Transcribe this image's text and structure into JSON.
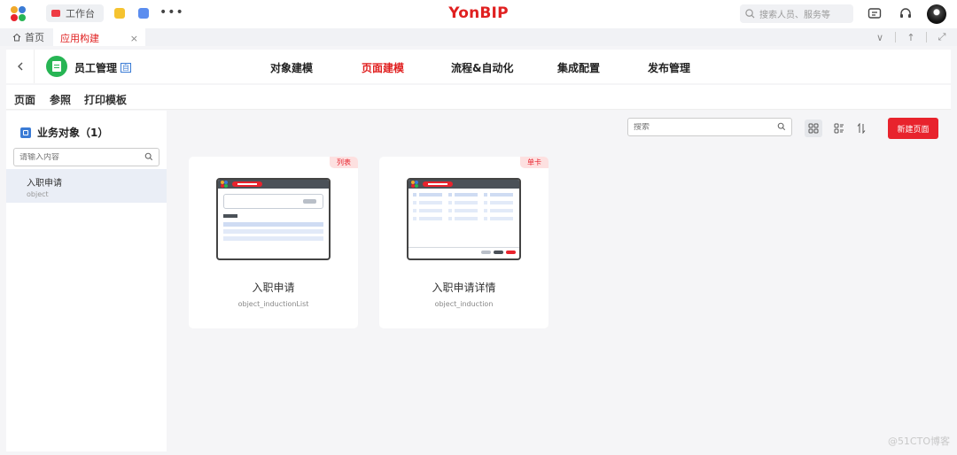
{
  "topbar": {
    "workbench_label": "工作台",
    "brand": "YonBIP",
    "search_placeholder": "搜索人员、服务等",
    "more_label": "•••"
  },
  "tabs": {
    "home_label": "首页",
    "active_label": "应用构建",
    "close_label": "×",
    "right_icons": [
      "∨",
      "↑",
      "⤢"
    ]
  },
  "header": {
    "app_name": "员工管理",
    "app_tag": "自",
    "nav": [
      "对象建模",
      "页面建模",
      "流程&自动化",
      "集成配置",
      "发布管理"
    ],
    "active_nav": "页面建模"
  },
  "subtabs": {
    "items": [
      "页面",
      "参照",
      "打印模板"
    ],
    "active": "页面"
  },
  "sidebar": {
    "title": "业务对象（1）",
    "search_placeholder": "请输入内容",
    "items": [
      {
        "name": "入职申请",
        "sub": "object"
      }
    ]
  },
  "main": {
    "search_placeholder": "搜索",
    "new_button": "新建页面",
    "cards": [
      {
        "tag": "列表",
        "name": "入职申请",
        "code": "object_inductionList"
      },
      {
        "tag": "单卡",
        "name": "入职申请详情",
        "code": "object_induction"
      }
    ]
  },
  "colors": {
    "accent": "#e8232d",
    "brand": "#e02020",
    "app_icon": "#27b554",
    "selected_row": "#eaeef6"
  },
  "watermark": "@51CTO博客"
}
